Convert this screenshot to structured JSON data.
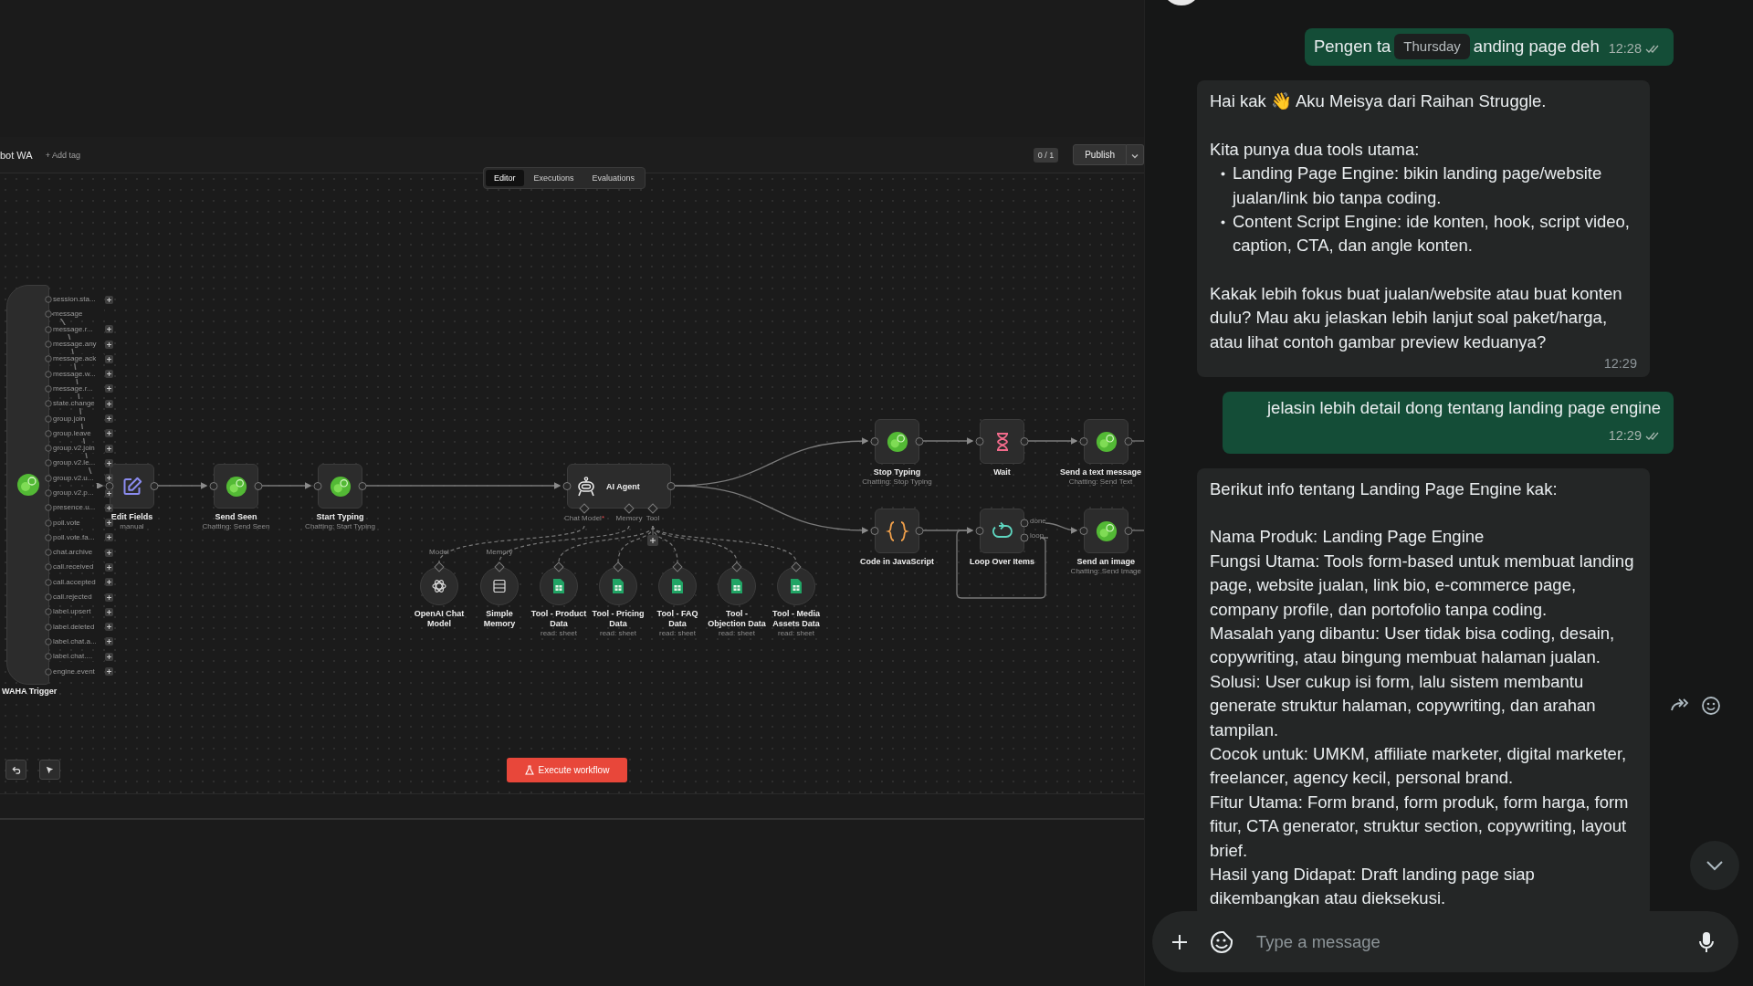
{
  "editor": {
    "workflow_name": "bot WA",
    "add_tag": "+ Add tag",
    "tabs": [
      {
        "label": "Editor",
        "selected": true
      },
      {
        "label": "Executions",
        "selected": false
      },
      {
        "label": "Evaluations",
        "selected": false
      }
    ],
    "version": "0 / 1",
    "publish": "Publish",
    "trigger": {
      "label": "WAHA Trigger",
      "outputs": [
        {
          "name": "session.sta...",
          "connected": false
        },
        {
          "name": "message",
          "connected": true
        },
        {
          "name": "message.r...",
          "connected": false
        },
        {
          "name": "message.any",
          "connected": false
        },
        {
          "name": "message.ack",
          "connected": false
        },
        {
          "name": "message.w...",
          "connected": false
        },
        {
          "name": "message.r...",
          "connected": false
        },
        {
          "name": "state.change",
          "connected": false
        },
        {
          "name": "group.join",
          "connected": false
        },
        {
          "name": "group.leave",
          "connected": false
        },
        {
          "name": "group.v2.join",
          "connected": false
        },
        {
          "name": "group.v2.le...",
          "connected": false
        },
        {
          "name": "group.v2.u...",
          "connected": false
        },
        {
          "name": "group.v2.p...",
          "connected": false
        },
        {
          "name": "presence.u...",
          "connected": false
        },
        {
          "name": "poll.vote",
          "connected": false
        },
        {
          "name": "poll.vote.fa...",
          "connected": false
        },
        {
          "name": "chat.archive",
          "connected": false
        },
        {
          "name": "call.received",
          "connected": false
        },
        {
          "name": "call.accepted",
          "connected": false
        },
        {
          "name": "call.rejected",
          "connected": false
        },
        {
          "name": "label.upsert",
          "connected": false
        },
        {
          "name": "label.deleted",
          "connected": false
        },
        {
          "name": "label.chat.a...",
          "connected": false
        },
        {
          "name": "label.chat....",
          "connected": false
        },
        {
          "name": "engine.event",
          "connected": false
        }
      ]
    },
    "nodes": [
      {
        "label": "Edit Fields",
        "subtitle": "manual",
        "kind": "edit"
      },
      {
        "label": "Send Seen",
        "subtitle": "Chatting: Send Seen",
        "kind": "chat"
      },
      {
        "label": "Start Typing",
        "subtitle": "Chatting: Start Typing",
        "kind": "chat"
      },
      {
        "label": "Stop Typing",
        "subtitle": "Chatting: Stop Typing",
        "kind": "chat"
      },
      {
        "label": "Wait",
        "kind": "wait"
      },
      {
        "label": "Send a text message",
        "subtitle": "Chatting: Send Text",
        "kind": "chat"
      },
      {
        "label": "Code in JavaScript",
        "kind": "code"
      },
      {
        "label": "Loop Over Items",
        "kind": "loop"
      },
      {
        "label": "Send an image",
        "subtitle": "Chatting: Send Image",
        "kind": "chat"
      }
    ],
    "agent": {
      "label": "AI Agent",
      "inputs": [
        {
          "label": "Chat Model",
          "required_mark": "*"
        },
        {
          "label": "Memory"
        },
        {
          "label": "Tool"
        }
      ]
    },
    "sub_nodes": [
      {
        "label": "OpenAI Chat Model",
        "handle": "Model",
        "kind": "model"
      },
      {
        "label": "Simple Memory",
        "handle": "Memory",
        "kind": "memory"
      },
      {
        "label": "Tool - Product Data",
        "subtitle": "read: sheet",
        "kind": "sheet"
      },
      {
        "label": "Tool - Pricing Data",
        "subtitle": "read: sheet",
        "kind": "sheet"
      },
      {
        "label": "Tool - FAQ Data",
        "subtitle": "read: sheet",
        "kind": "sheet"
      },
      {
        "label": "Tool - Objection Data",
        "subtitle": "read: sheet",
        "kind": "sheet"
      },
      {
        "label": "Tool - Media Assets Data",
        "subtitle": "read: sheet",
        "kind": "sheet"
      }
    ],
    "loop_outputs": [
      "done",
      "loop"
    ],
    "execute": "Execute workflow"
  },
  "chat": {
    "messages": [
      {
        "kind": "out",
        "parts": [
          "Pengen ta",
          "anding page deh"
        ],
        "date_chip": "Thursday",
        "time": "12:28"
      },
      {
        "kind": "in",
        "time": "12:29",
        "paragraphs": [
          [
            {
              "kind": "line",
              "text": "Hai kak 👋 Aku Meisya dari Raihan Struggle."
            }
          ],
          [
            {
              "kind": "line",
              "text": "Kita punya dua tools utama:"
            },
            {
              "kind": "bullet",
              "text": "Landing Page Engine: bikin landing page/website jualan/link bio tanpa coding."
            },
            {
              "kind": "bullet",
              "text": "Content Script Engine: ide konten, hook, script video, caption, CTA, dan angle konten."
            }
          ],
          [
            {
              "kind": "line",
              "text": "Kakak lebih fokus buat jualan/website atau buat konten dulu? Mau aku jelaskan lebih lanjut soal paket/harga, atau lihat contoh gambar preview keduanya?"
            }
          ]
        ]
      },
      {
        "kind": "out",
        "parts": [
          "jelasin lebih detail dong tentang landing page engine"
        ],
        "time": "12:29"
      },
      {
        "kind": "in",
        "paragraphs": [
          [
            {
              "kind": "line",
              "text": "Berikut info tentang Landing Page Engine kak:"
            }
          ],
          [
            {
              "kind": "line",
              "text": "Nama Produk: Landing Page Engine"
            },
            {
              "kind": "line",
              "text": "Fungsi Utama: Tools form-based untuk membuat landing page, website jualan, link bio, e-commerce page, company profile, dan portofolio tanpa coding."
            },
            {
              "kind": "line",
              "text": "Masalah yang dibantu: User tidak bisa coding, desain, copywriting, atau bingung membuat halaman jualan."
            },
            {
              "kind": "line",
              "text": "Solusi: User cukup isi form, lalu sistem membantu generate struktur halaman, copywriting, dan arahan tampilan."
            },
            {
              "kind": "line",
              "text": "Cocok untuk: UMKM, affiliate marketer, digital marketer, freelancer, agency kecil, personal brand."
            },
            {
              "kind": "line",
              "text": "Fitur Utama: Form brand, form produk, form harga, form fitur, CTA generator, struktur section, copywriting, layout brief."
            },
            {
              "kind": "line",
              "text": "Hasil yang Didapat: Draft landing page siap dikembangkan atau dieksekusi."
            }
          ]
        ]
      }
    ],
    "placeholder": "Type a message"
  }
}
